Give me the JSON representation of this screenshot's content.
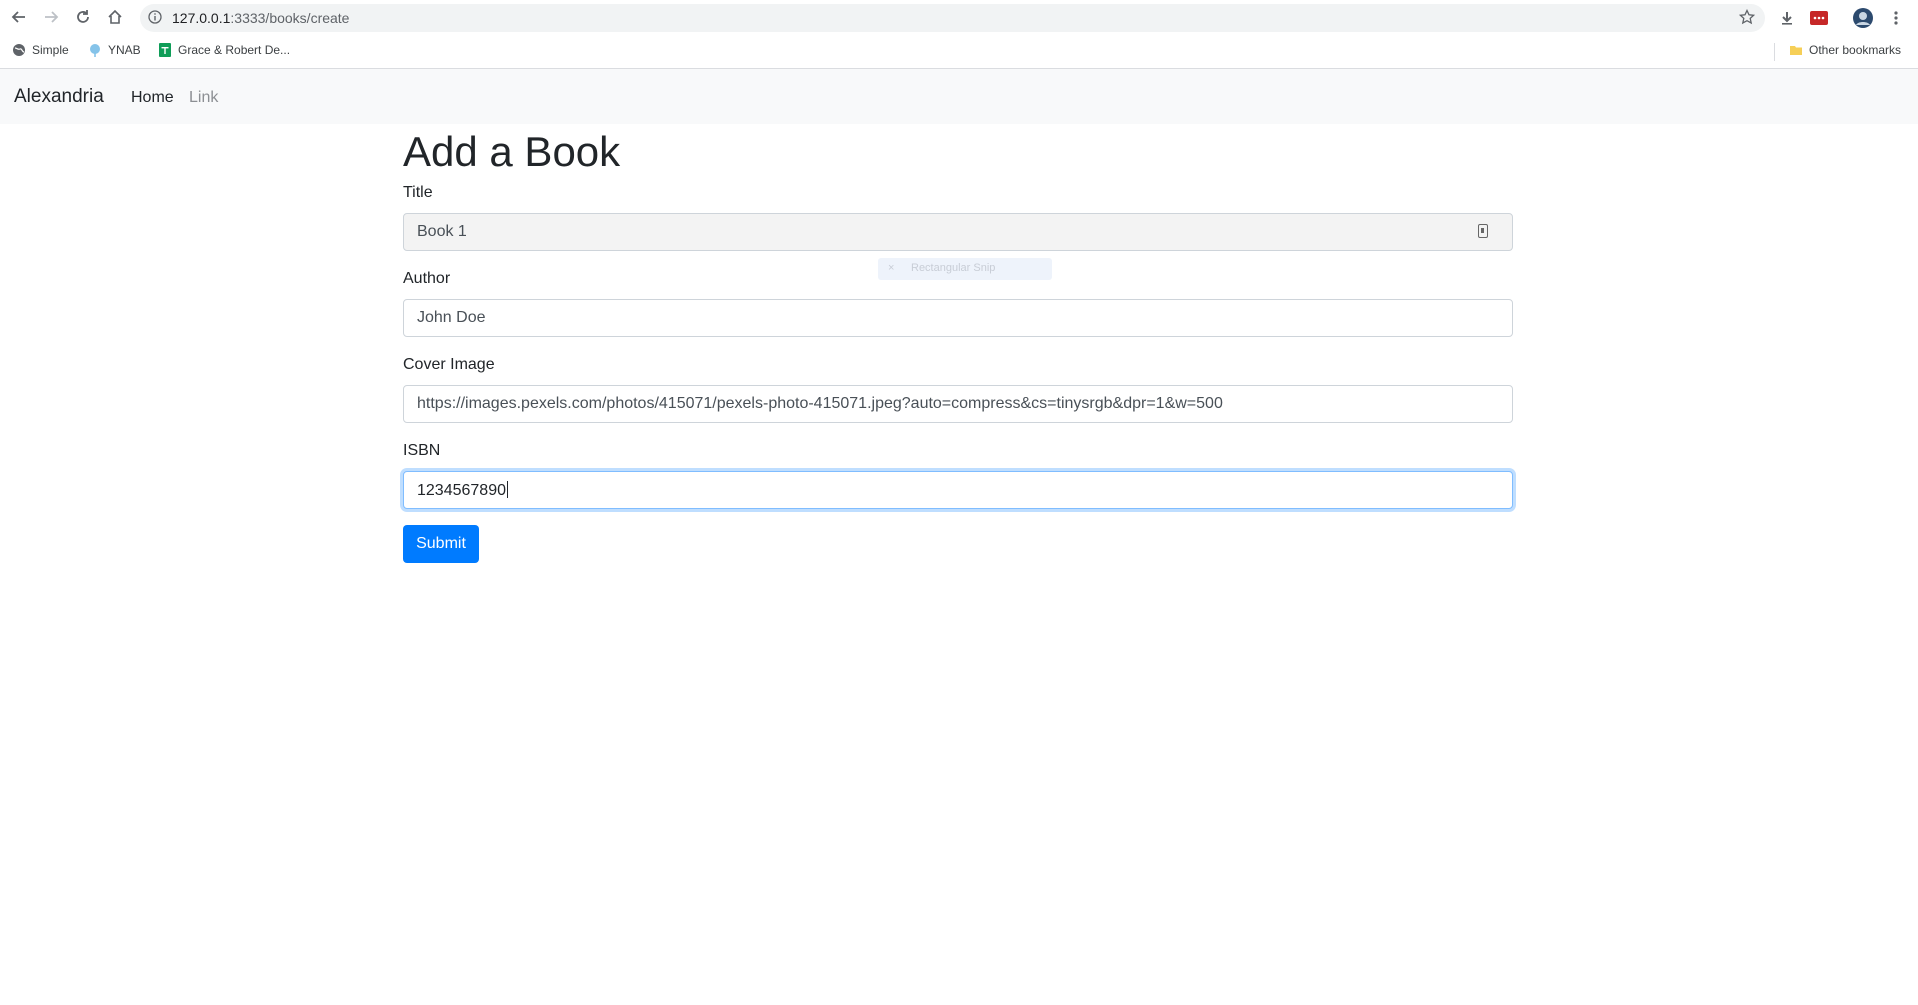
{
  "browser": {
    "url_host": "127.0.0.1",
    "url_path": ":3333/books/create",
    "bookmarks": [
      {
        "label": "Simple",
        "icon": "globe-icon"
      },
      {
        "label": "YNAB",
        "icon": "tree-icon"
      },
      {
        "label": "Grace & Robert De...",
        "icon": "sheets-icon"
      }
    ],
    "other_bookmarks": "Other bookmarks"
  },
  "navbar": {
    "brand": "Alexandria",
    "links": [
      "Home",
      "Link"
    ]
  },
  "page": {
    "heading": "Add a Book",
    "fields": {
      "title": {
        "label": "Title",
        "value": "Book 1"
      },
      "author": {
        "label": "Author",
        "value": "John Doe"
      },
      "cover": {
        "label": "Cover Image",
        "value": "https://images.pexels.com/photos/415071/pexels-photo-415071.jpeg?auto=compress&cs=tinysrgb&dpr=1&w=500"
      },
      "isbn": {
        "label": "ISBN",
        "value": "1234567890"
      }
    },
    "submit_label": "Submit"
  },
  "overlay": {
    "snip_label": "Rectangular Snip",
    "snip_close": "×"
  },
  "colors": {
    "primary": "#007bff",
    "navbar_bg": "#f8f9fa",
    "focus_border": "#80bdff"
  }
}
